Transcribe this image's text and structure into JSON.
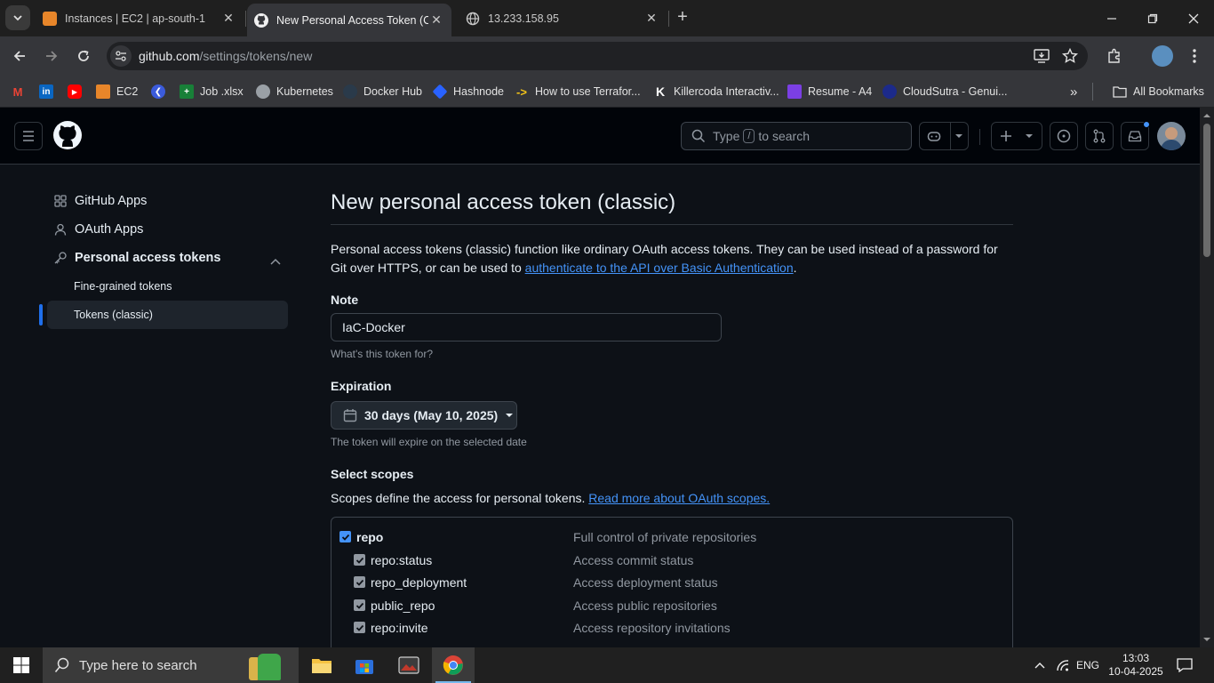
{
  "browser": {
    "tabs": [
      {
        "title": "Instances | EC2 | ap-south-1",
        "favicon": "aws-ec2-icon"
      },
      {
        "title": "New Personal Access Token (Cla",
        "favicon": "github-icon"
      },
      {
        "title": "13.233.158.95",
        "favicon": "globe-icon"
      }
    ],
    "url_host": "github.com",
    "url_path": "/settings/tokens/new",
    "bookmarks": [
      "EC2",
      "Job .xlsx",
      "Kubernetes",
      "Docker Hub",
      "Hashnode",
      "How to use Terrafor...",
      "Killercoda Interactiv...",
      "Resume - A4",
      "CloudSutra - Genui..."
    ],
    "all_bookmarks": "All Bookmarks"
  },
  "header": {
    "search_prefix": "Type",
    "search_key": "/",
    "search_suffix": "to search"
  },
  "sidebar": {
    "items": [
      {
        "label": "GitHub Apps",
        "icon": "apps-icon"
      },
      {
        "label": "OAuth Apps",
        "icon": "person-icon"
      },
      {
        "label": "Personal access tokens",
        "icon": "key-icon"
      }
    ],
    "subitems": [
      "Fine-grained tokens",
      "Tokens (classic)"
    ]
  },
  "main": {
    "title": "New personal access token (classic)",
    "intro_text": "Personal access tokens (classic) function like ordinary OAuth access tokens. They can be used instead of a password for Git over HTTPS, or can be used to ",
    "intro_link": "authenticate to the API over Basic Authentication",
    "intro_end": ".",
    "note_label": "Note",
    "note_value": "IaC-Docker",
    "note_hint": "What's this token for?",
    "expiration_label": "Expiration",
    "expiration_value": "30 days (May 10, 2025)",
    "expiration_hint": "The token will expire on the selected date",
    "scopes_label": "Select scopes",
    "scopes_text": "Scopes define the access for personal tokens. ",
    "scopes_link": "Read more about OAuth scopes.",
    "scopes": [
      {
        "name": "repo",
        "desc": "Full control of private repositories",
        "checked": true
      },
      {
        "name": "repo:status",
        "desc": "Access commit status",
        "checked": true
      },
      {
        "name": "repo_deployment",
        "desc": "Access deployment status",
        "checked": true
      },
      {
        "name": "public_repo",
        "desc": "Access public repositories",
        "checked": true
      },
      {
        "name": "repo:invite",
        "desc": "Access repository invitations",
        "checked": true
      }
    ]
  },
  "taskbar": {
    "search_placeholder": "Type here to search",
    "language": "ENG",
    "time": "13:03",
    "date": "10-04-2025"
  }
}
